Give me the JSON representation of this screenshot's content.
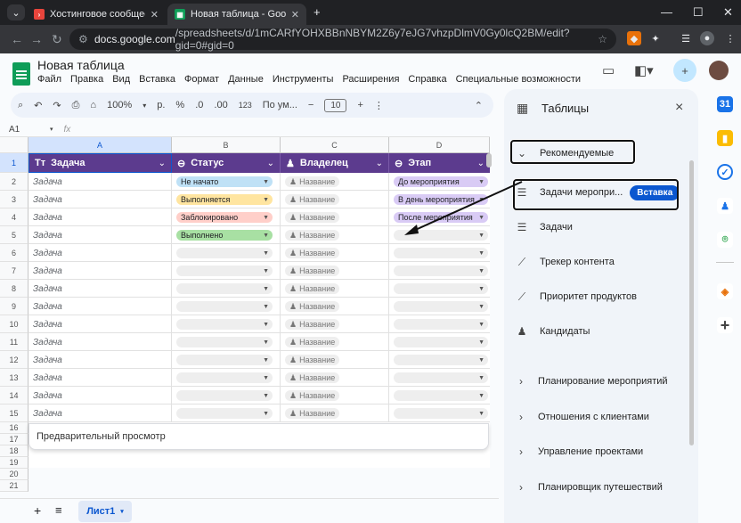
{
  "browser": {
    "tabs": [
      {
        "title": "Хостинговое сообщество «Tim",
        "active": false
      },
      {
        "title": "Новая таблица - Google Табли",
        "active": true
      }
    ],
    "url_host": "docs.google.com",
    "url_path": "/spreadsheets/d/1mCARfYOHXBBnNBYM2Z6y7eJG7vhzpDlmV0Gy0lcQ2BM/edit?gid=0#gid=0",
    "new_tab": "+",
    "window_controls": {
      "minimize": "—",
      "maximize": "☐",
      "close": "✕"
    }
  },
  "doc": {
    "title": "Новая таблица",
    "menu": [
      "Файл",
      "Правка",
      "Вид",
      "Вставка",
      "Формат",
      "Данные",
      "Инструменты",
      "Расширения",
      "Справка",
      "Специальные возможности"
    ]
  },
  "toolbar": {
    "zoom": "100%",
    "currency": "р.",
    "percent": "%",
    "dec_minus": ".0",
    "dec_plus": ".00",
    "num_format": "123",
    "font": "По ум...",
    "font_size": "10",
    "minus": "−",
    "plus": "+"
  },
  "formula_bar": {
    "cell_ref": "A1",
    "fx": "fx"
  },
  "columns": [
    "A",
    "B",
    "C",
    "D"
  ],
  "header_row": {
    "row_num": "1",
    "cells": [
      {
        "icon": "Tт",
        "label": "Задача"
      },
      {
        "icon": "⊖",
        "label": "Статус"
      },
      {
        "icon": "👤",
        "label": "Владелец"
      },
      {
        "icon": "⊖",
        "label": "Этап"
      }
    ]
  },
  "rows": [
    {
      "num": "2",
      "task": "Задача",
      "status": "Не начато",
      "status_color": "#bfe1f6",
      "owner": "Название",
      "stage": "До мероприятия",
      "stage_color": "#d9cbf5"
    },
    {
      "num": "3",
      "task": "Задача",
      "status": "Выполняется",
      "status_color": "#ffe5a0",
      "owner": "Название",
      "stage": "В день мероприятия",
      "stage_color": "#d9cbf5"
    },
    {
      "num": "4",
      "task": "Задача",
      "status": "Заблокировано",
      "status_color": "#ffcfc9",
      "owner": "Название",
      "stage": "После мероприятия",
      "stage_color": "#d9cbf5"
    },
    {
      "num": "5",
      "task": "Задача",
      "status": "Выполнено",
      "status_color": "#a8e0a3",
      "owner": "Название",
      "stage": "",
      "stage_color": "#eeeeee"
    },
    {
      "num": "6",
      "task": "Задача",
      "status": "",
      "status_color": "#eeeeee",
      "owner": "Название",
      "stage": "",
      "stage_color": "#eeeeee"
    },
    {
      "num": "7",
      "task": "Задача",
      "status": "",
      "status_color": "#eeeeee",
      "owner": "Название",
      "stage": "",
      "stage_color": "#eeeeee"
    },
    {
      "num": "8",
      "task": "Задача",
      "status": "",
      "status_color": "#eeeeee",
      "owner": "Название",
      "stage": "",
      "stage_color": "#eeeeee"
    },
    {
      "num": "9",
      "task": "Задача",
      "status": "",
      "status_color": "#eeeeee",
      "owner": "Название",
      "stage": "",
      "stage_color": "#eeeeee"
    },
    {
      "num": "10",
      "task": "Задача",
      "status": "",
      "status_color": "#eeeeee",
      "owner": "Название",
      "stage": "",
      "stage_color": "#eeeeee"
    },
    {
      "num": "11",
      "task": "Задача",
      "status": "",
      "status_color": "#eeeeee",
      "owner": "Название",
      "stage": "",
      "stage_color": "#eeeeee"
    },
    {
      "num": "12",
      "task": "Задача",
      "status": "",
      "status_color": "#eeeeee",
      "owner": "Название",
      "stage": "",
      "stage_color": "#eeeeee"
    },
    {
      "num": "13",
      "task": "Задача",
      "status": "",
      "status_color": "#eeeeee",
      "owner": "Название",
      "stage": "",
      "stage_color": "#eeeeee"
    },
    {
      "num": "14",
      "task": "Задача",
      "status": "",
      "status_color": "#eeeeee",
      "owner": "Название",
      "stage": "",
      "stage_color": "#eeeeee"
    },
    {
      "num": "15",
      "task": "Задача",
      "status": "",
      "status_color": "#eeeeee",
      "owner": "Название",
      "stage": "",
      "stage_color": "#eeeeee"
    }
  ],
  "extra_rows": [
    "16",
    "17",
    "18",
    "19",
    "20",
    "21"
  ],
  "preview_label": "Предварительный просмотр",
  "sheets": {
    "add": "+",
    "list": "≡",
    "active": "Лист1"
  },
  "panel": {
    "title": "Таблицы",
    "close": "×",
    "recommended": "Рекомендуемые",
    "items": [
      {
        "label": "Задачи меропри...",
        "icon": "checklist-icon"
      },
      {
        "label": "Задачи",
        "icon": "checklist-icon"
      },
      {
        "label": "Трекер контента",
        "icon": "trend-icon"
      },
      {
        "label": "Приоритет продуктов",
        "icon": "trend-icon"
      },
      {
        "label": "Кандидаты",
        "icon": "person-icon"
      }
    ],
    "insert_button": "Вставка",
    "sections": [
      "Планирование мероприятий",
      "Отношения с клиентами",
      "Управление проектами",
      "Планировщик путешествий"
    ]
  },
  "colors": {
    "header_purple": "#5c3b8e",
    "accent_blue": "#0b57d0",
    "annotation": "#111111"
  }
}
